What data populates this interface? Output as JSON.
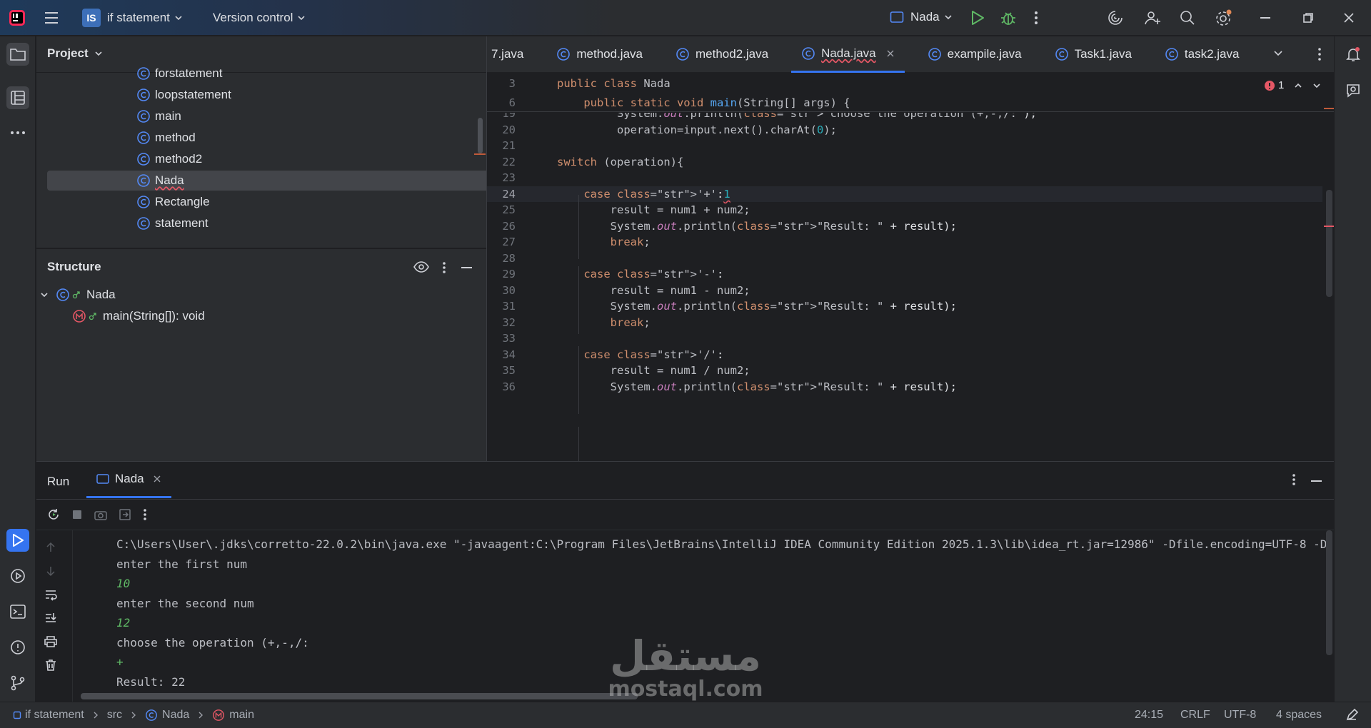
{
  "titlebar": {
    "project_badge": "IS",
    "project_name": "if statement",
    "vcs": "Version control",
    "run_config": "Nada"
  },
  "project_panel": {
    "title": "Project",
    "items": [
      {
        "label": "forstatement"
      },
      {
        "label": "loopstatement"
      },
      {
        "label": "main"
      },
      {
        "label": "method"
      },
      {
        "label": "method2"
      },
      {
        "label": "Nada",
        "selected": true
      },
      {
        "label": "Rectangle"
      },
      {
        "label": "statement"
      }
    ]
  },
  "structure_panel": {
    "title": "Structure",
    "class_name": "Nada",
    "method_sig": "main(String[]): void"
  },
  "editor": {
    "tabs": [
      "7.java",
      "method.java",
      "method2.java",
      "Nada.java",
      "exampile.java",
      "Task1.java",
      "task2.java"
    ],
    "active_tab": "Nada.java",
    "error_count": "1",
    "sticky": [
      {
        "ln": "3",
        "code": "public class Nada"
      },
      {
        "ln": "6",
        "code": "    public static void main(String[] args) {"
      }
    ],
    "lines": [
      {
        "ln": "19",
        "code": "         System.out.println(\"choose the operation (+,-,/:\");"
      },
      {
        "ln": "20",
        "code": "         operation=input.next().charAt(0);"
      },
      {
        "ln": "21",
        "code": ""
      },
      {
        "ln": "22",
        "code": "switch (operation){"
      },
      {
        "ln": "23",
        "code": ""
      },
      {
        "ln": "24",
        "code": "    case '+':1"
      },
      {
        "ln": "25",
        "code": "        result = num1 + num2;"
      },
      {
        "ln": "26",
        "code": "        System.out.println(\"Result: \" + result);"
      },
      {
        "ln": "27",
        "code": "        break;"
      },
      {
        "ln": "28",
        "code": ""
      },
      {
        "ln": "29",
        "code": "    case '-':"
      },
      {
        "ln": "30",
        "code": "        result = num1 - num2;"
      },
      {
        "ln": "31",
        "code": "        System.out.println(\"Result: \" + result);"
      },
      {
        "ln": "32",
        "code": "        break;"
      },
      {
        "ln": "33",
        "code": ""
      },
      {
        "ln": "34",
        "code": "    case '/':"
      },
      {
        "ln": "35",
        "code": "        result = num1 / num2;"
      },
      {
        "ln": "36",
        "code": "        System.out.println(\"Result: \" + result);"
      }
    ]
  },
  "run_panel": {
    "title": "Run",
    "tab": "Nada",
    "output": [
      {
        "text": "C:\\Users\\User\\.jdks\\corretto-22.0.2\\bin\\java.exe \"-javaagent:C:\\Program Files\\JetBrains\\IntelliJ IDEA Community Edition 2025.1.3\\lib\\idea_rt.jar=12986\" -Dfile.encoding=UTF-8 -D",
        "kind": "sys"
      },
      {
        "text": "enter the first num",
        "kind": "sys"
      },
      {
        "text": "10",
        "kind": "input"
      },
      {
        "text": "enter the second num",
        "kind": "sys"
      },
      {
        "text": "12",
        "kind": "input"
      },
      {
        "text": "choose the operation (+,-,/:",
        "kind": "sys"
      },
      {
        "text": "+",
        "kind": "input"
      },
      {
        "text": "Result: 22",
        "kind": "sys"
      }
    ]
  },
  "statusbar": {
    "crumbs": [
      "if statement",
      "src",
      "Nada",
      "main"
    ],
    "position": "24:15",
    "line_sep": "CRLF",
    "encoding": "UTF-8",
    "indent": "4 spaces"
  },
  "watermark": {
    "arabic": "مستقل",
    "latin": "mostaql.com"
  },
  "colors": {
    "accent": "#3574f0",
    "keyword": "#cf8e6d",
    "string": "#6aab73",
    "input_green": "#5fb865",
    "error": "#e55765"
  }
}
